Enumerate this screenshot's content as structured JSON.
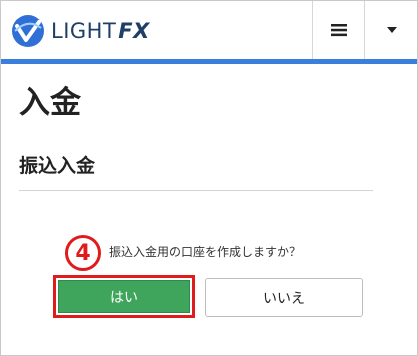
{
  "header": {
    "logo_light": "LIGHT",
    "logo_fx": "FX",
    "menu_icon": "hamburger-icon",
    "dropdown_icon": "caret-down-icon",
    "accent_color": "#3a7fdc"
  },
  "page": {
    "title": "入金",
    "section_title": "振込入金"
  },
  "dialog": {
    "step_number": "4",
    "question": "振込入金用の口座を作成しますか？",
    "yes_label": "はい",
    "no_label": "いいえ",
    "yes_color": "#3fa55c",
    "highlight_color": "#e01b1b"
  }
}
